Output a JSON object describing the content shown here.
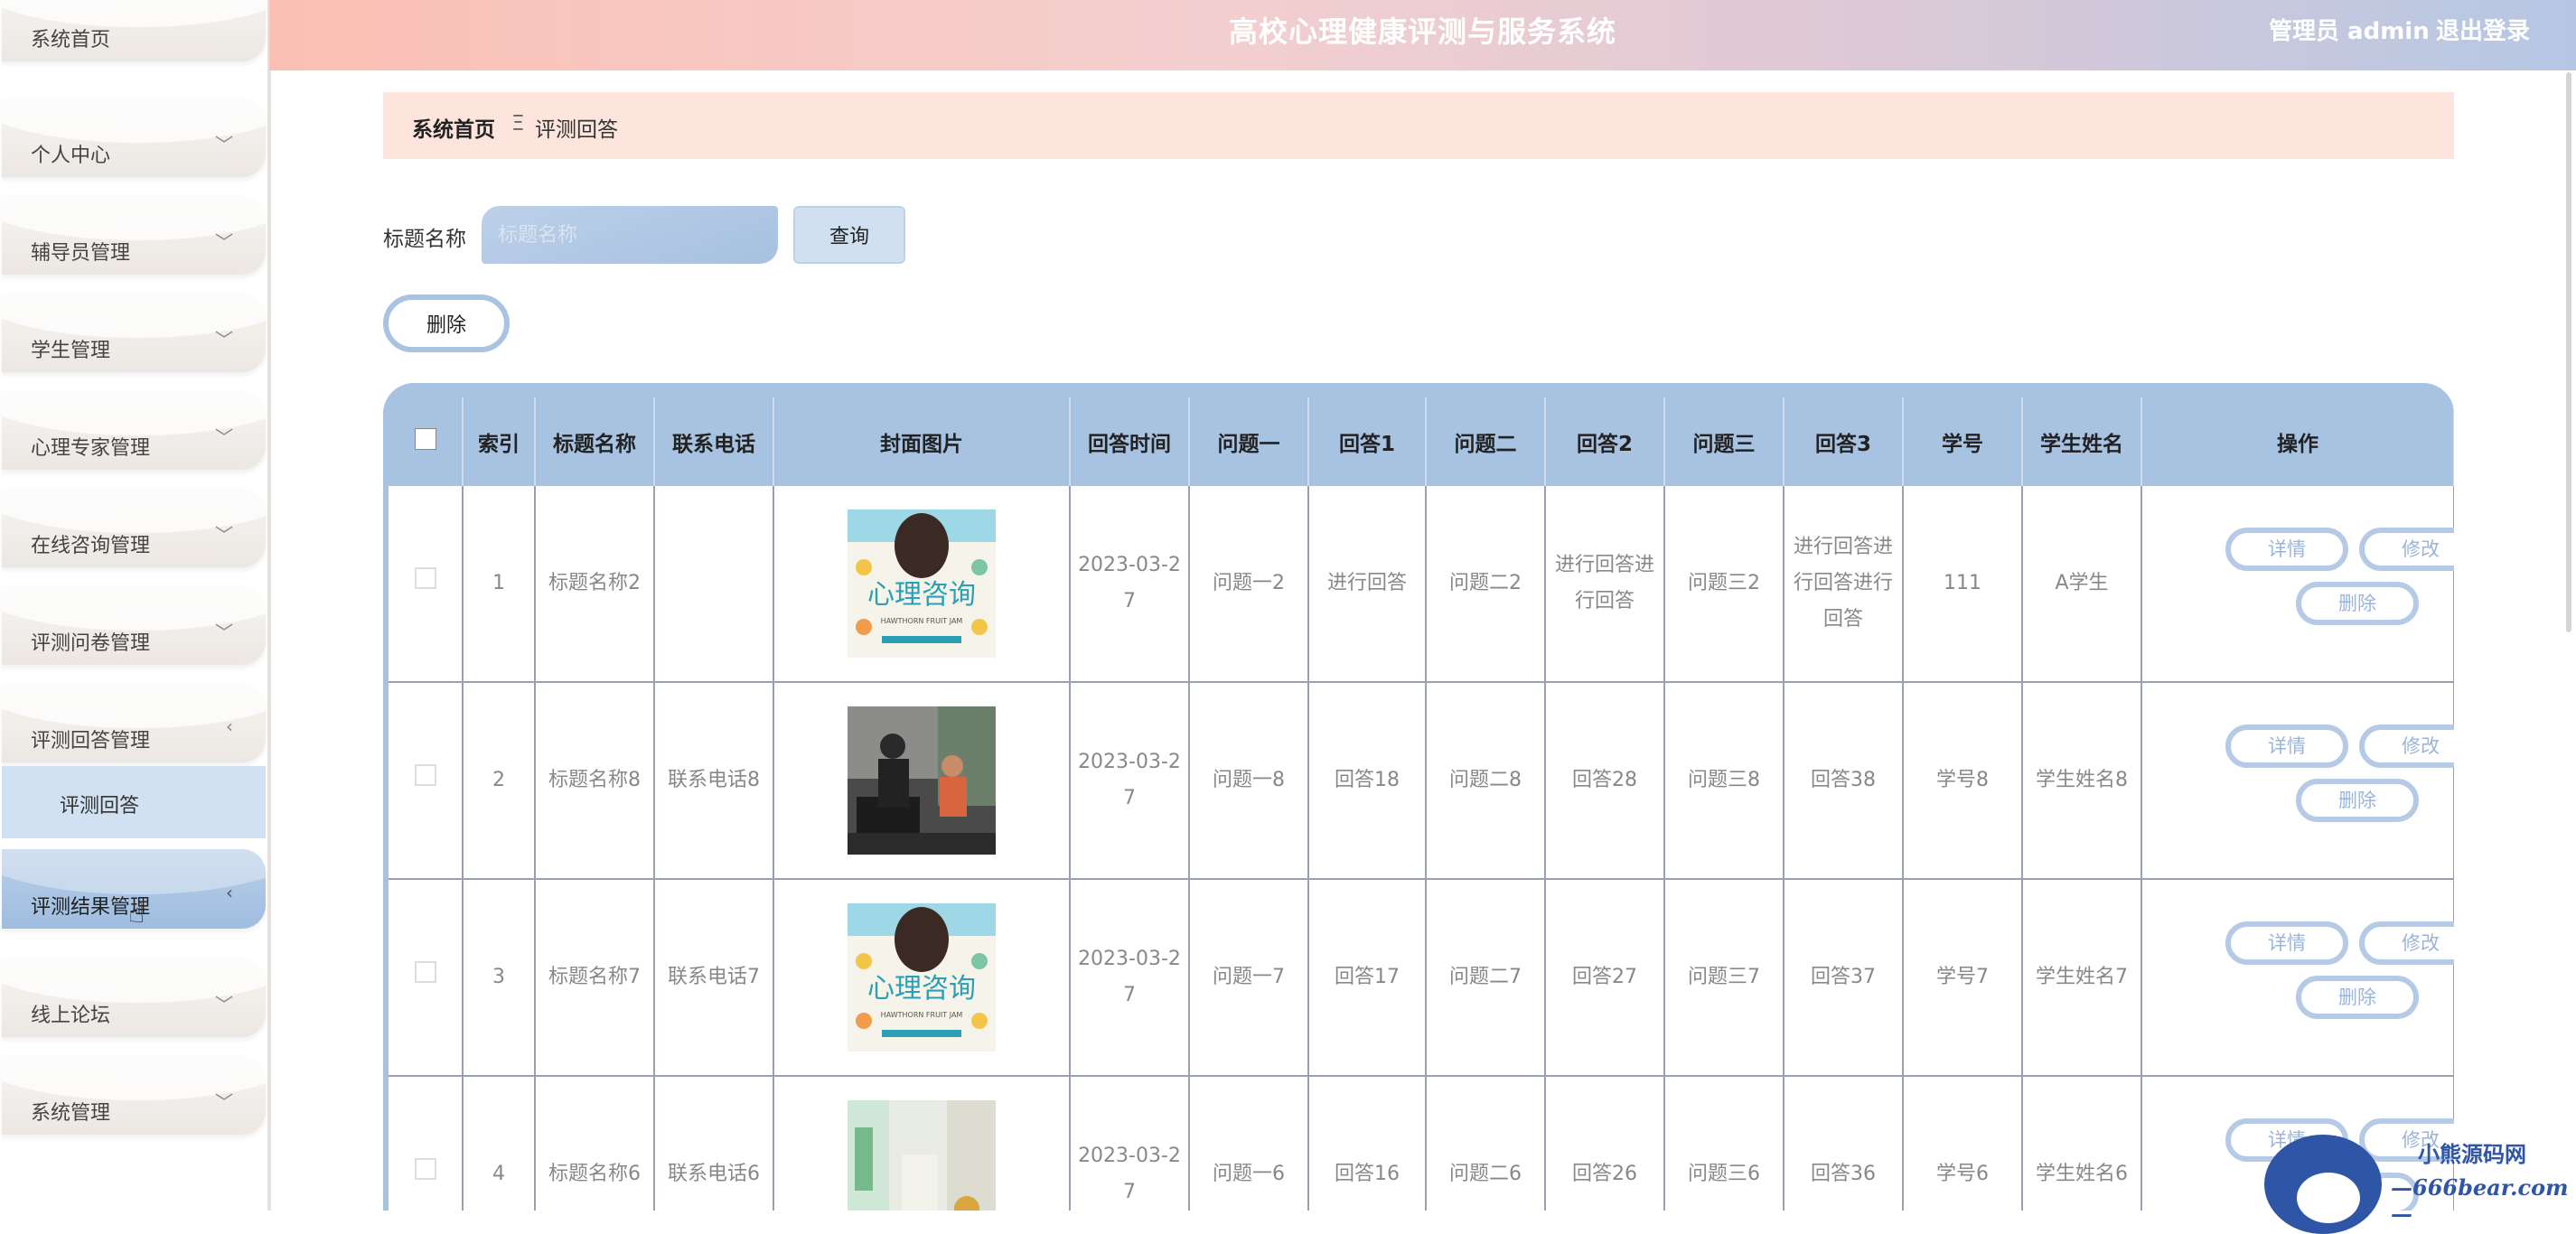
{
  "header": {
    "title": "高校心理健康评测与服务系统",
    "role": "管理员 admin",
    "logout": "退出登录"
  },
  "sidebar": {
    "items": [
      {
        "label": "系统首页",
        "chevron": ""
      },
      {
        "label": "个人中心",
        "chevron": "﹀"
      },
      {
        "label": "辅导员管理",
        "chevron": "﹀"
      },
      {
        "label": "学生管理",
        "chevron": "﹀"
      },
      {
        "label": "心理专家管理",
        "chevron": "﹀"
      },
      {
        "label": "在线咨询管理",
        "chevron": "﹀"
      },
      {
        "label": "评测问卷管理",
        "chevron": "﹀"
      },
      {
        "label": "评测回答管理",
        "chevron": "‹"
      },
      {
        "label": "评测结果管理",
        "chevron": "‹"
      },
      {
        "label": "线上论坛",
        "chevron": "﹀"
      },
      {
        "label": "系统管理",
        "chevron": "﹀"
      }
    ],
    "submenu_label": "评测回答"
  },
  "breadcrumb": {
    "home": "系统首页",
    "separator": "Ξ",
    "current": "评测回答"
  },
  "search": {
    "label": "标题名称",
    "placeholder": "标题名称",
    "button": "查询"
  },
  "actions": {
    "delete": "删除"
  },
  "table": {
    "headers": [
      "索引",
      "标题名称",
      "联系电话",
      "封面图片",
      "回答时间",
      "问题一",
      "回答1",
      "问题二",
      "回答2",
      "问题三",
      "回答3",
      "学号",
      "学生姓名",
      "操作"
    ],
    "rows": [
      {
        "index": "1",
        "title": "标题名称2",
        "phone": "",
        "time": "2023-03-27",
        "q1": "问题一2",
        "a1": "进行回答",
        "q2": "问题二2",
        "a2": "进行回答进行回答",
        "q3": "问题三2",
        "a3": "进行回答进行回答进行回答",
        "student_no": "111",
        "student_name": "A学生",
        "cover": "poster"
      },
      {
        "index": "2",
        "title": "标题名称8",
        "phone": "联系电话8",
        "time": "2023-03-27",
        "q1": "问题一8",
        "a1": "回答18",
        "q2": "问题二8",
        "a2": "回答28",
        "q3": "问题三8",
        "a3": "回答38",
        "student_no": "学号8",
        "student_name": "学生姓名8",
        "cover": "photo-dark"
      },
      {
        "index": "3",
        "title": "标题名称7",
        "phone": "联系电话7",
        "time": "2023-03-27",
        "q1": "问题一7",
        "a1": "回答17",
        "q2": "问题二7",
        "a2": "回答27",
        "q3": "问题三7",
        "a3": "回答37",
        "student_no": "学号7",
        "student_name": "学生姓名7",
        "cover": "poster"
      },
      {
        "index": "4",
        "title": "标题名称6",
        "phone": "联系电话6",
        "time": "2023-03-27",
        "q1": "问题一6",
        "a1": "回答16",
        "q2": "问题二6",
        "a2": "回答26",
        "q3": "问题三6",
        "a3": "回答36",
        "student_no": "学号6",
        "student_name": "学生姓名6",
        "cover": "photo-light"
      }
    ],
    "row_actions": {
      "detail": "详情",
      "edit": "修改",
      "delete": "删除"
    }
  },
  "cover_poster": {
    "main_text": "心理咨询",
    "sub_text": "HAWTHORN FRUIT JAM"
  },
  "watermark": {
    "line1": "小熊源码网",
    "line2": "—666bear.com—"
  },
  "colors": {
    "accent": "#a8c2e2",
    "breadcrumb_bg": "#fde4dc",
    "active_menu": "#9fbde0"
  }
}
